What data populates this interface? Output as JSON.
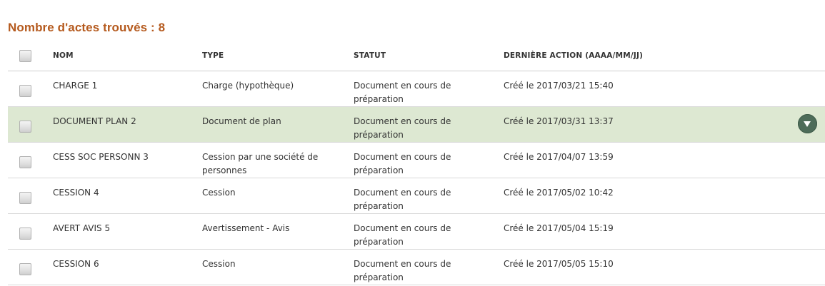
{
  "results_count": {
    "label": "Nombre d'actes trouvés : 8",
    "color": "#b55a1e"
  },
  "table": {
    "headers": {
      "name": "NOM",
      "type": "TYPE",
      "status": "STATUT",
      "last_action": "DERNIÈRE ACTION (AAAA/MM/JJ)"
    },
    "rows": [
      {
        "name": "CHARGE 1",
        "type": "Charge (hypothèque)",
        "status": "Document en cours de préparation",
        "last_action": "Créé le 2017/03/21 15:40",
        "selected": false
      },
      {
        "name": "DOCUMENT PLAN 2",
        "type": "Document de plan",
        "status": "Document en cours de préparation",
        "last_action": "Créé le 2017/03/31 13:37",
        "selected": true
      },
      {
        "name": "CESS SOC PERSONN 3",
        "type": "Cession par une société de personnes",
        "status": "Document en cours de préparation",
        "last_action": "Créé le 2017/04/07 13:59",
        "selected": false
      },
      {
        "name": "CESSION 4",
        "type": "Cession",
        "status": "Document en cours de préparation",
        "last_action": "Créé le 2017/05/02 10:42",
        "selected": false
      },
      {
        "name": "AVERT AVIS 5",
        "type": "Avertissement - Avis",
        "status": "Document en cours de préparation",
        "last_action": "Créé le 2017/05/04 15:19",
        "selected": false
      },
      {
        "name": "CESSION 6",
        "type": "Cession",
        "status": "Document en cours de préparation",
        "last_action": "Créé le 2017/05/05 15:10",
        "selected": false
      }
    ]
  },
  "row_action_icon": "chevron-down-circle-icon",
  "colors": {
    "selected_row_bg": "#dde8d2",
    "action_button": "#4d6c59"
  }
}
